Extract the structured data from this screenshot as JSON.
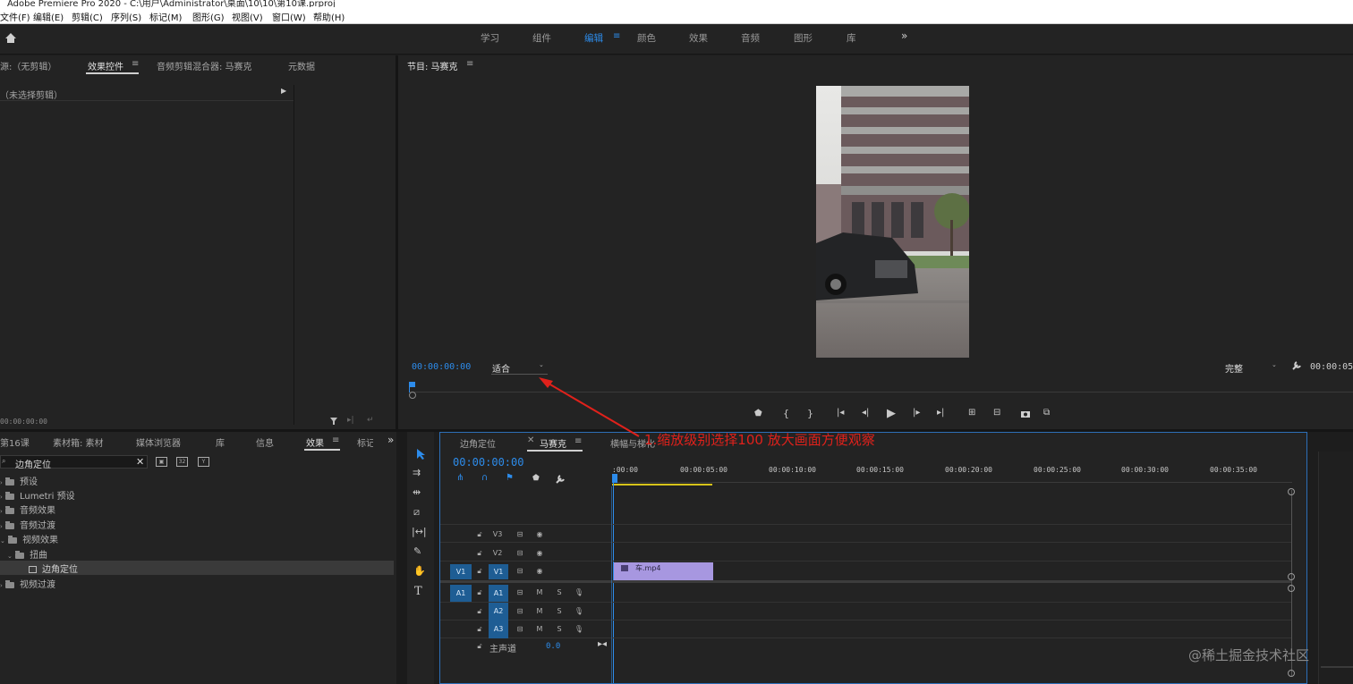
{
  "window": {
    "title": "Adobe Premiere Pro 2020 - C:\\用户\\Administrator\\桌面\\10\\10\\第10课.prproj"
  },
  "menu": [
    "文件(F)",
    "编辑(E)",
    "剪辑(C)",
    "序列(S)",
    "标记(M)",
    "图形(G)",
    "视图(V)",
    "窗口(W)",
    "帮助(H)"
  ],
  "workspaces": {
    "items": [
      "学习",
      "组件",
      "编辑",
      "颜色",
      "效果",
      "音频",
      "图形",
      "库"
    ],
    "active": "编辑",
    "more": "»"
  },
  "source_panel": {
    "tabs": [
      "源:（无剪辑）",
      "效果控件",
      "音频剪辑混合器: 马赛克",
      "元数据"
    ],
    "active_tab": "效果控件",
    "no_clip": "（未选择剪辑）",
    "timecode": "00:00:00:00"
  },
  "program_monitor": {
    "title": "节目: 马赛克",
    "timecode": "00:00:00:00",
    "zoom": "适合",
    "quality": "完整",
    "duration": "00:00:05"
  },
  "project_panel": {
    "tabs": [
      "第16课",
      "素材箱: 素材",
      "媒体浏览器",
      "库",
      "信息",
      "效果",
      "标记"
    ],
    "active_tab": "效果",
    "search_value": "边角定位",
    "tree": [
      {
        "label": "预设",
        "level": 0
      },
      {
        "label": "Lumetri 预设",
        "level": 0
      },
      {
        "label": "音频效果",
        "level": 0
      },
      {
        "label": "音频过渡",
        "level": 0
      },
      {
        "label": "视频效果",
        "level": 0
      },
      {
        "label": "扭曲",
        "level": 1
      },
      {
        "label": "边角定位",
        "level": 2,
        "selected": true
      },
      {
        "label": "视频过渡",
        "level": 0
      }
    ]
  },
  "timeline": {
    "tabs": [
      "边角定位",
      "马赛克",
      "横幅与梯化"
    ],
    "active_tab": "马赛克",
    "timecode": "00:00:00:00",
    "ruler": [
      ":00:00",
      "00:00:05:00",
      "00:00:10:00",
      "00:00:15:00",
      "00:00:20:00",
      "00:00:25:00",
      "00:00:30:00",
      "00:00:35:00"
    ],
    "video_tracks": [
      "V3",
      "V2",
      "V1"
    ],
    "audio_tracks": [
      "A1",
      "A2",
      "A3"
    ],
    "source_v": "V1",
    "source_a": "A1",
    "master": {
      "label": "主声道",
      "value": "0.0"
    },
    "clip": {
      "name": "车.mp4",
      "color": "#a797e0"
    }
  },
  "annotation": {
    "text": "1.缩放级别选择100 放大画面方便观察",
    "color": "#e0211b"
  },
  "watermark": "@稀土掘金技术社区"
}
